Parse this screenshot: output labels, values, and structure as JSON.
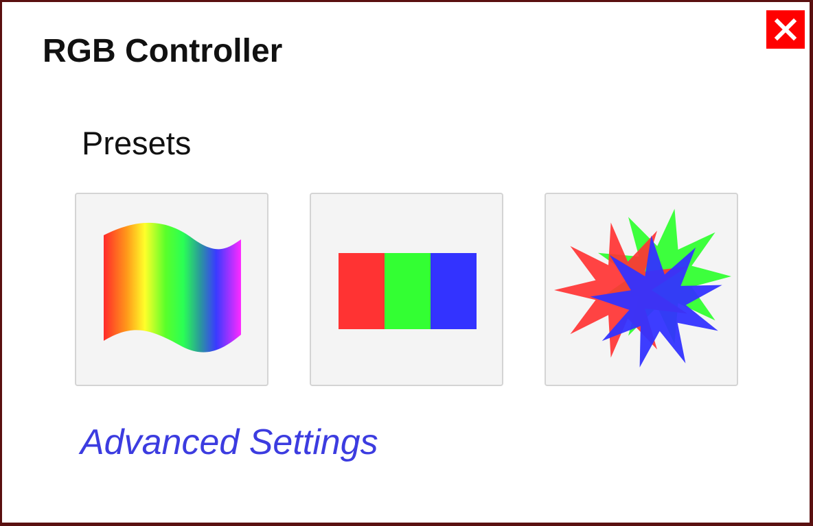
{
  "dialog": {
    "title": "RGB Controller",
    "close_icon": "close-x-icon",
    "close_color": "#ff0000"
  },
  "presets": {
    "heading": "Presets",
    "items": [
      {
        "icon": "rainbow-flag-icon"
      },
      {
        "icon": "rgb-bars-icon",
        "colors": [
          "#ff3333",
          "#33ff33",
          "#3333ff"
        ]
      },
      {
        "icon": "color-burst-icon",
        "colors": [
          "#ff3333",
          "#33ff33",
          "#3333ff"
        ]
      }
    ]
  },
  "advanced": {
    "label": "Advanced Settings",
    "color": "#3c3ce0"
  }
}
